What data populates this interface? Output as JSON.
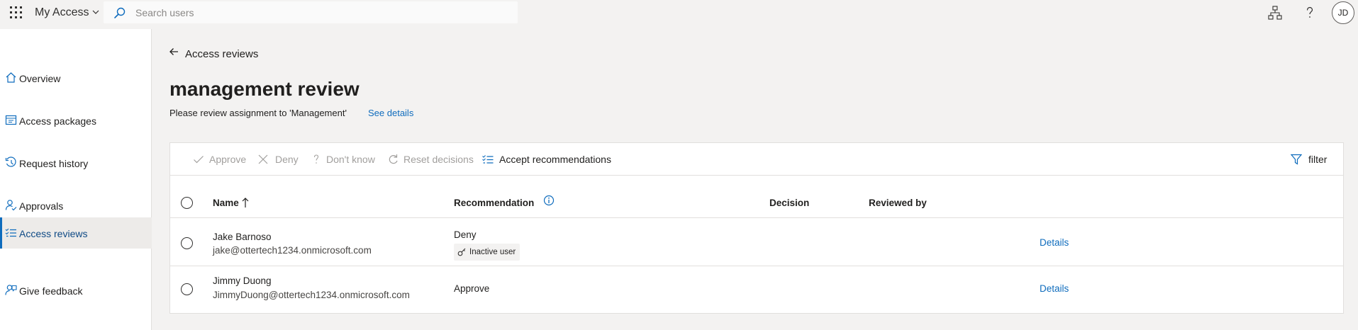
{
  "header": {
    "app_name": "My Access",
    "search_placeholder": "Search users",
    "avatar_initials": "JD",
    "icons": [
      "waffle-icon",
      "chevron-down-icon",
      "search-icon",
      "org-chart-icon",
      "help-icon"
    ]
  },
  "sidebar": {
    "items": [
      {
        "label": "Overview",
        "icon": "home-icon"
      },
      {
        "label": "Access packages",
        "icon": "package-icon"
      },
      {
        "label": "Request history",
        "icon": "history-icon"
      },
      {
        "label": "Approvals",
        "icon": "person-check-icon"
      },
      {
        "label": "Access reviews",
        "icon": "checklist-icon",
        "active": true
      },
      {
        "label": "Give feedback",
        "icon": "feedback-icon"
      }
    ]
  },
  "main": {
    "back_label": "Access reviews",
    "title": "management review",
    "subtitle": "Please review assignment to 'Management'",
    "see_details": "See details"
  },
  "toolbar": {
    "approve": "Approve",
    "deny": "Deny",
    "dont_know": "Don't know",
    "reset": "Reset decisions",
    "accept": "Accept recommendations",
    "filter": "filter"
  },
  "table": {
    "columns": {
      "name": "Name",
      "recommendation": "Recommendation",
      "decision": "Decision",
      "reviewed_by": "Reviewed by"
    },
    "rows": [
      {
        "name": "Jake Barnoso",
        "email": "jake@ottertech1234.onmicrosoft.com",
        "recommendation": "Deny",
        "badge": "Inactive user",
        "details": "Details"
      },
      {
        "name": "Jimmy Duong",
        "email": "JimmyDuong@ottertech1234.onmicrosoft.com",
        "recommendation": "Approve",
        "details": "Details"
      }
    ]
  },
  "colors": {
    "accent": "#0f6cbd",
    "background": "#f3f2f1",
    "disabled_text": "#a19f9d"
  }
}
